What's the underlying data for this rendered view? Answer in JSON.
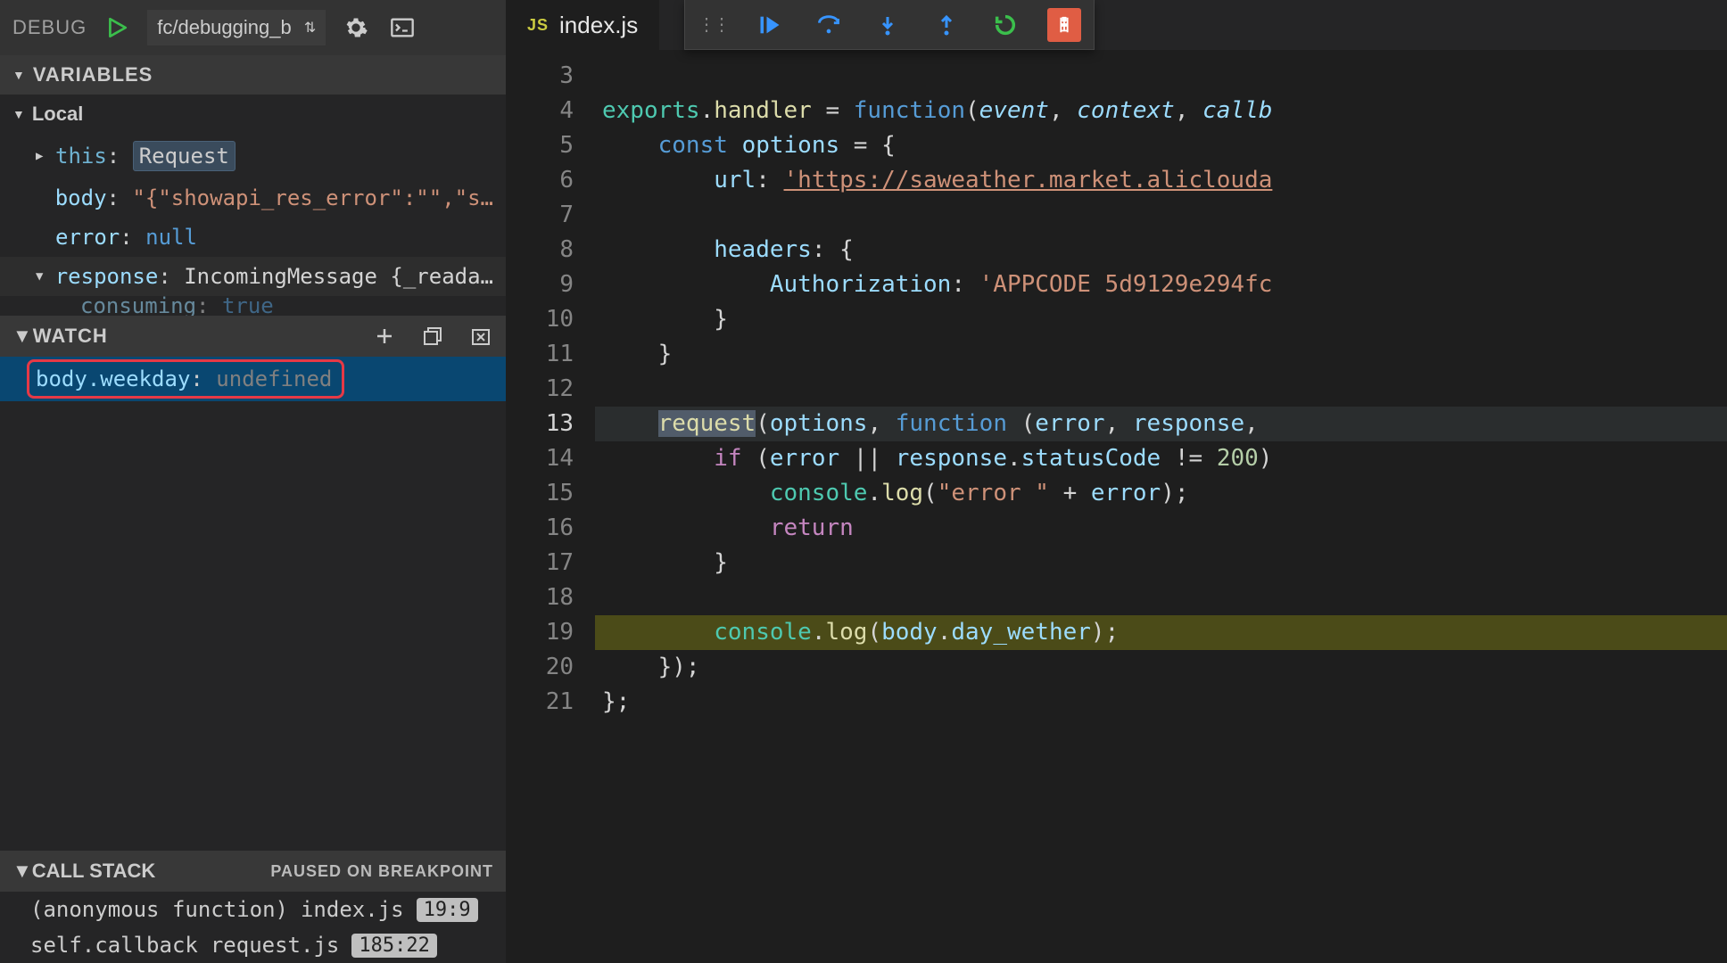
{
  "debugTop": {
    "label": "DEBUG",
    "config": "fc/debugging_b"
  },
  "panels": {
    "variables": "VARIABLES",
    "watch": "WATCH",
    "callstack": "CALL STACK",
    "pausedBadge": "PAUSED ON BREAKPOINT"
  },
  "scope": {
    "local": "Local"
  },
  "vars": {
    "this_k": "this",
    "this_v": "Request",
    "body_k": "body",
    "body_v": "\"{\"showapi_res_error\":\"\",\"s…",
    "error_k": "error",
    "error_v": "null",
    "response_k": "response",
    "response_v": "IncomingMessage {_reada…",
    "consuming_k": "consuming",
    "consuming_v": "true"
  },
  "watch": {
    "expr": "body.weekday",
    "val": "undefined"
  },
  "stack": [
    {
      "fn": "(anonymous function)",
      "file": "index.js",
      "loc": "19:9"
    },
    {
      "fn": "self.callback",
      "file": "request.js",
      "loc": "185:22"
    }
  ],
  "tab": {
    "icon": "JS",
    "name": "index.js"
  },
  "lines": [
    3,
    4,
    5,
    6,
    7,
    8,
    9,
    10,
    11,
    12,
    13,
    14,
    15,
    16,
    17,
    18,
    19,
    20,
    21
  ],
  "code": {
    "l4_exports": "exports",
    "l4_handler": "handler",
    "l4_fn": "function",
    "l4_p1": "event",
    "l4_p2": "context",
    "l4_p3": "callb",
    "l5_const": "const",
    "l5_opt": "options",
    "l6_url": "url",
    "l6_urlv": "'https://saweather.market.aliclouda",
    "l8_headers": "headers",
    "l9_auth": "Authorization",
    "l9_authv": "'APPCODE 5d9129e294fc",
    "l13_req": "request",
    "l13_opt": "options",
    "l13_fn": "function",
    "l13_p1": "error",
    "l13_p2": "response",
    "l14_if": "if",
    "l14_err": "error",
    "l14_resp": "response",
    "l14_sc": "statusCode",
    "l14_200": "200",
    "l15_console": "console",
    "l15_log": "log",
    "l15_str": "\"error \"",
    "l15_err": "error",
    "l16_return": "return",
    "l19_console": "console",
    "l19_log": "log",
    "l19_body": "body",
    "l19_prop": "day_wether"
  }
}
